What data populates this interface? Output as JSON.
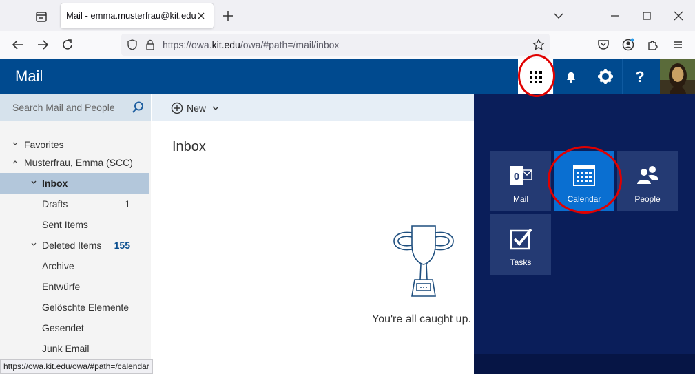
{
  "browser": {
    "tab_title": "Mail - emma.musterfrau@kit.edu",
    "url_prefix": "https://owa.",
    "url_domain": "kit.edu",
    "url_suffix": "/owa/#path=/mail/inbox",
    "status_url": "https://owa.kit.edu/owa/#path=/calendar"
  },
  "header": {
    "app_title": "Mail"
  },
  "search": {
    "placeholder": "Search Mail and People"
  },
  "folders": [
    {
      "label": "Favorites",
      "count": ""
    },
    {
      "label": "Musterfrau, Emma (SCC)",
      "count": ""
    },
    {
      "label": "Inbox",
      "count": ""
    },
    {
      "label": "Drafts",
      "count": "1"
    },
    {
      "label": "Sent Items",
      "count": ""
    },
    {
      "label": "Deleted Items",
      "count": "155"
    },
    {
      "label": "Archive",
      "count": ""
    },
    {
      "label": "Entwürfe",
      "count": ""
    },
    {
      "label": "Gelöschte Elemente",
      "count": ""
    },
    {
      "label": "Gesendet",
      "count": ""
    },
    {
      "label": "Junk Email",
      "count": ""
    }
  ],
  "toolbar": {
    "new_label": "New"
  },
  "main": {
    "title": "Inbox",
    "empty_message": "You're all caught up."
  },
  "launcher": {
    "tiles": [
      {
        "label": "Mail",
        "icon": "outlook-icon"
      },
      {
        "label": "Calendar",
        "icon": "calendar-icon"
      },
      {
        "label": "People",
        "icon": "people-icon"
      },
      {
        "label": "Tasks",
        "icon": "tasks-icon"
      }
    ]
  },
  "colors": {
    "header_bg": "#004a8f",
    "launcher_bg": "#0a1e5a",
    "active_tile": "#0a6fd1",
    "highlight_ring": "#e00000"
  }
}
